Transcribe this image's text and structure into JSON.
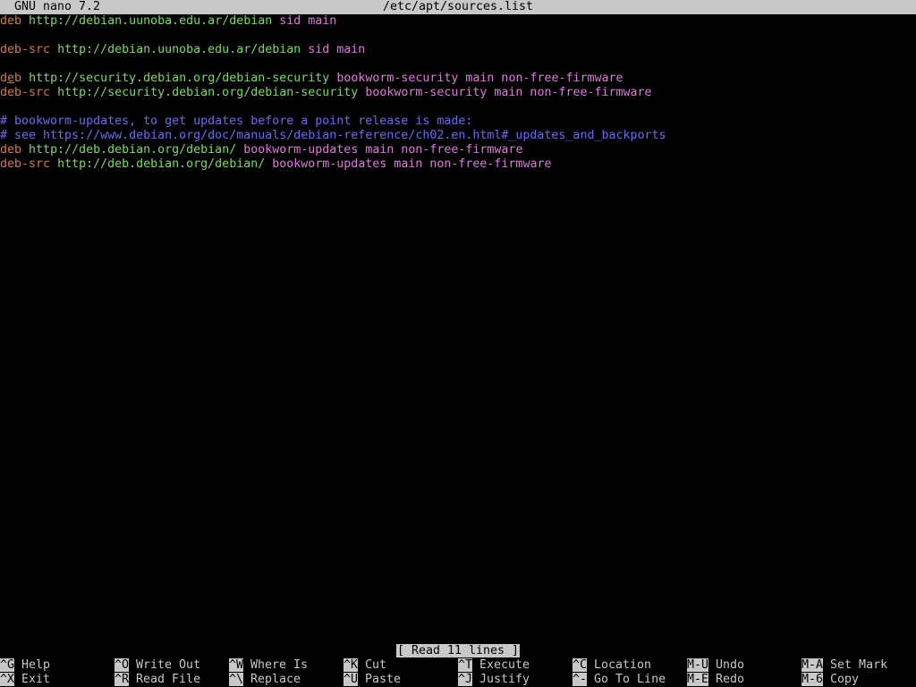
{
  "titlebar": {
    "app": "GNU nano 7.2",
    "file": "/etc/apt/sources.list"
  },
  "lines": [
    [
      {
        "t": "deb",
        "c": "kw"
      },
      {
        "t": " "
      },
      {
        "t": "http://debian.uunoba.edu.ar/debian",
        "c": "url"
      },
      {
        "t": " "
      },
      {
        "t": "sid main",
        "c": "comp"
      }
    ],
    [],
    [
      {
        "t": "deb-src",
        "c": "kw"
      },
      {
        "t": " "
      },
      {
        "t": "http://debian.uunoba.edu.ar/debian",
        "c": "url"
      },
      {
        "t": " "
      },
      {
        "t": "sid main",
        "c": "comp"
      }
    ],
    [],
    [
      {
        "t": "d",
        "c": "kw"
      },
      {
        "t": "e",
        "c": "kw cursor"
      },
      {
        "t": "b",
        "c": "kw"
      },
      {
        "t": " "
      },
      {
        "t": "http://security.debian.org/debian-security",
        "c": "url"
      },
      {
        "t": " "
      },
      {
        "t": "bookworm-security main non-free-firmware",
        "c": "comp"
      }
    ],
    [
      {
        "t": "deb-src",
        "c": "kw"
      },
      {
        "t": " "
      },
      {
        "t": "http://security.debian.org/debian-security",
        "c": "url"
      },
      {
        "t": " "
      },
      {
        "t": "bookworm-security main non-free-firmware",
        "c": "comp"
      }
    ],
    [],
    [
      {
        "t": "# bookworm-updates, to get updates before a point release is made:",
        "c": "cmt"
      }
    ],
    [
      {
        "t": "# see https://www.debian.org/doc/manuals/debian-reference/ch02.en.html#_updates_and_backports",
        "c": "cmt"
      }
    ],
    [
      {
        "t": "deb",
        "c": "kw"
      },
      {
        "t": " "
      },
      {
        "t": "http://deb.debian.org/debian/",
        "c": "url"
      },
      {
        "t": " "
      },
      {
        "t": "bookworm-updates main non-free-firmware",
        "c": "comp"
      }
    ],
    [
      {
        "t": "deb-src",
        "c": "kw"
      },
      {
        "t": " "
      },
      {
        "t": "http://deb.debian.org/debian/",
        "c": "url"
      },
      {
        "t": " "
      },
      {
        "t": "bookworm-updates main non-free-firmware",
        "c": "comp"
      }
    ]
  ],
  "status": "[ Read 11 lines ]",
  "shortcuts": [
    {
      "key": "^G",
      "label": "Help"
    },
    {
      "key": "^X",
      "label": "Exit"
    },
    {
      "key": "^O",
      "label": "Write Out"
    },
    {
      "key": "^R",
      "label": "Read File"
    },
    {
      "key": "^W",
      "label": "Where Is"
    },
    {
      "key": "^\\",
      "label": "Replace"
    },
    {
      "key": "^K",
      "label": "Cut"
    },
    {
      "key": "^U",
      "label": "Paste"
    },
    {
      "key": "^T",
      "label": "Execute"
    },
    {
      "key": "^J",
      "label": "Justify"
    },
    {
      "key": "^C",
      "label": "Location"
    },
    {
      "key": "^-",
      "label": "Go To Line"
    },
    {
      "key": "M-U",
      "label": "Undo"
    },
    {
      "key": "M-E",
      "label": "Redo"
    },
    {
      "key": "M-A",
      "label": "Set Mark"
    },
    {
      "key": "M-6",
      "label": "Copy"
    }
  ],
  "colors": {
    "keyword": "#d07a50",
    "url": "#7fd86a",
    "component": "#d77fd7",
    "comment": "#6b6bf0",
    "bar": "#c8c8c8"
  }
}
